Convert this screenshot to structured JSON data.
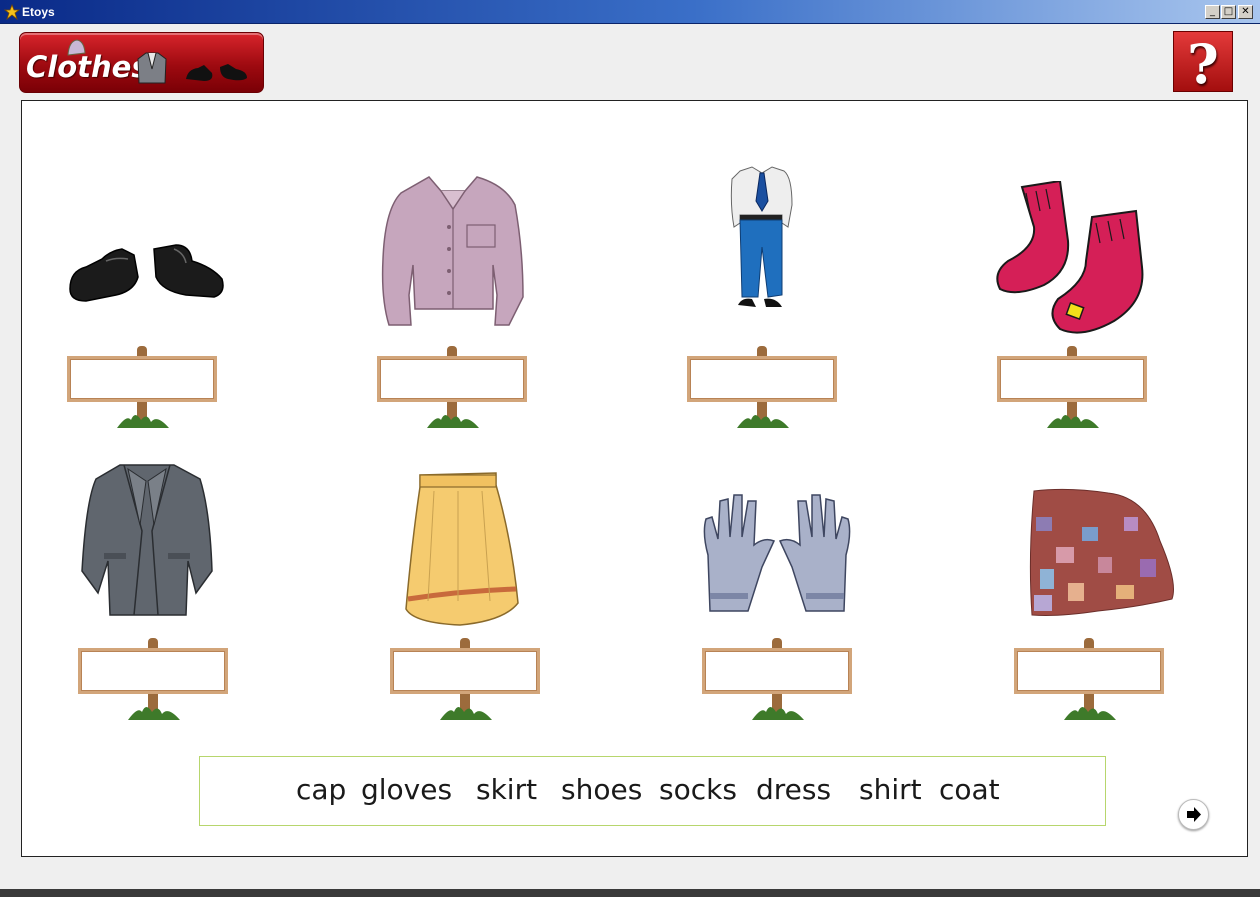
{
  "window": {
    "title": "Etoys",
    "minimize_label": "_",
    "maximize_label": "□",
    "close_label": "✕"
  },
  "header": {
    "logo_text": "Clothes",
    "help_label": "?"
  },
  "items": [
    {
      "icon": "shoes-icon"
    },
    {
      "icon": "shirt-icon"
    },
    {
      "icon": "boy-in-shirt-and-trousers-icon"
    },
    {
      "icon": "socks-icon"
    },
    {
      "icon": "coat-icon"
    },
    {
      "icon": "skirt-icon"
    },
    {
      "icon": "gloves-icon"
    },
    {
      "icon": "cap-icon"
    }
  ],
  "word_bank": [
    "cap",
    "gloves",
    "skirt",
    "shoes",
    "socks",
    "dress",
    "shirt",
    "coat"
  ],
  "colors": {
    "title_bar": "#0a2a88",
    "logo_red": "#b0121a",
    "sign_frame": "#d2a57a",
    "word_bank_border": "#b7d66d"
  }
}
